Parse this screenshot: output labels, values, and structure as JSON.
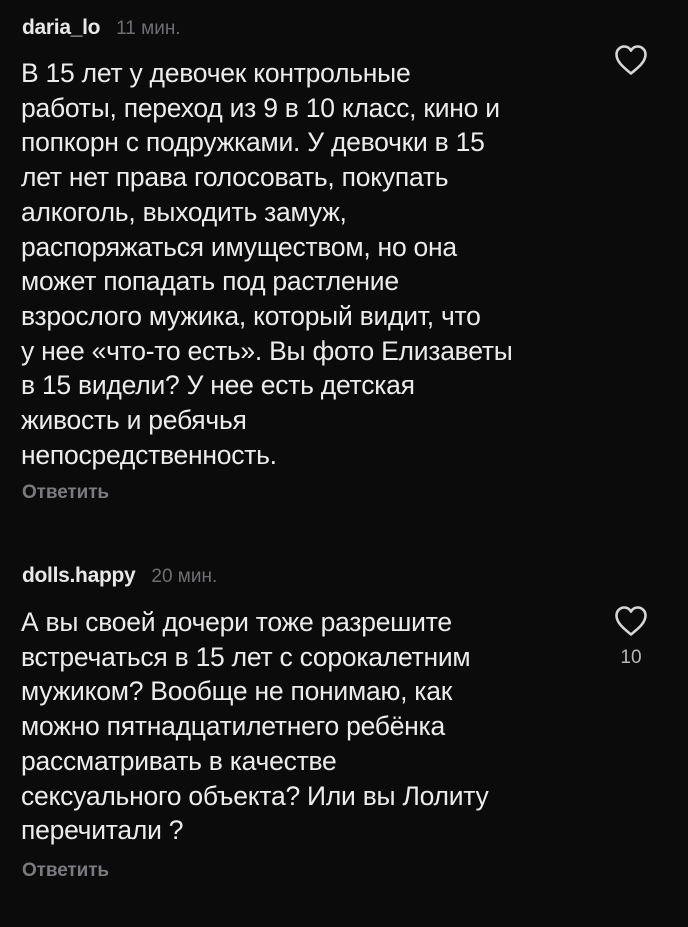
{
  "comments": [
    {
      "username": "daria_lo",
      "time": "11 мин.",
      "lines": [
        "В 15 лет у девочек контрольные",
        "работы, переход из 9 в 10 класс, кино и",
        "попкорн с подружками. У девочки в 15",
        "лет нет права голосовать, покупать",
        "алкоголь, выходить замуж,",
        "распоряжаться имуществом, но она",
        "может попадать под растление",
        "взрослого мужика, который видит, что",
        "у нее «что-то есть». Вы фото Елизаветы",
        "в 15 видели? У нее есть детская",
        "живость и ребячья",
        "непосредственность."
      ],
      "reply_label": "Ответить",
      "likes": ""
    },
    {
      "username": "dolls.happy",
      "time": "20 мин.",
      "lines": [
        "А вы своей дочери тоже разрешите",
        "встречаться в 15 лет с сорокалетним",
        "мужиком? Вообще не понимаю, как",
        "можно пятнадцатилетнего ребёнка",
        "рассматривать в качестве",
        "сексуального объекта? Или вы Лолиту",
        "перечитали ?"
      ],
      "reply_label": "Ответить",
      "likes": "10"
    }
  ],
  "icons": {
    "like": "heart-outline-icon"
  },
  "colors": {
    "background": "#0b0b0c",
    "text": "#ececec",
    "muted": "#6f6f73",
    "icon": "#d6d6d8"
  }
}
